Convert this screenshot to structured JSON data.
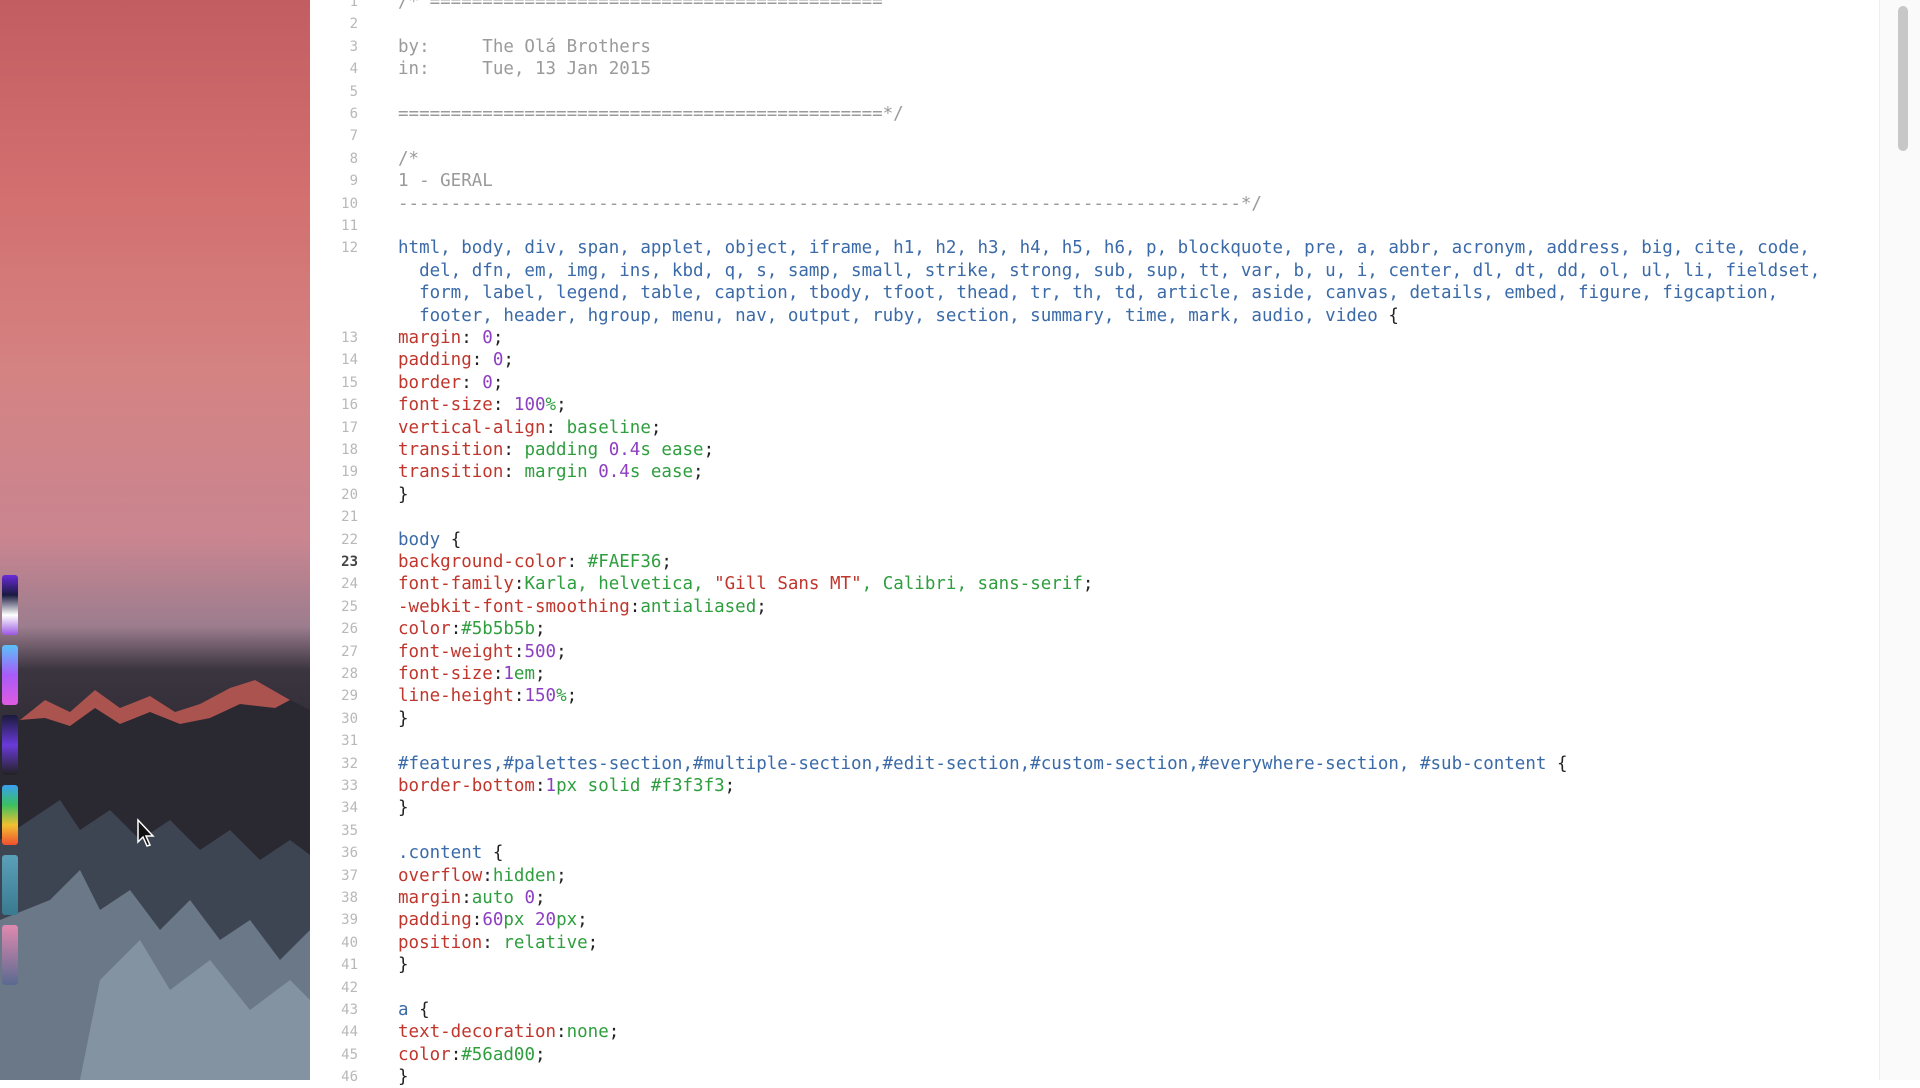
{
  "editor": {
    "lines": [
      {
        "n": "1",
        "tokens": [
          {
            "c": "comment",
            "t": "/* ==========================================="
          }
        ]
      },
      {
        "n": "2",
        "tokens": []
      },
      {
        "n": "3",
        "tokens": [
          {
            "c": "comment",
            "t": "by:     The Olá Brothers"
          }
        ]
      },
      {
        "n": "4",
        "tokens": [
          {
            "c": "comment",
            "t": "in:     Tue, 13 Jan 2015"
          }
        ]
      },
      {
        "n": "5",
        "tokens": []
      },
      {
        "n": "6",
        "tokens": [
          {
            "c": "comment",
            "t": "==============================================*/"
          }
        ]
      },
      {
        "n": "7",
        "tokens": []
      },
      {
        "n": "8",
        "tokens": [
          {
            "c": "comment",
            "t": "/*"
          }
        ]
      },
      {
        "n": "9",
        "tokens": [
          {
            "c": "comment",
            "t": "1 - GERAL"
          }
        ]
      },
      {
        "n": "10",
        "tokens": [
          {
            "c": "comment",
            "t": "--------------------------------------------------------------------------------*/"
          }
        ]
      },
      {
        "n": "11",
        "tokens": []
      },
      {
        "n": "12",
        "tokens": [
          {
            "c": "sel",
            "t": "html, body, div, span, applet, object, iframe, h1, h2, h3, h4, h5, h6, p, blockquote, pre, a, abbr, acronym, address, big, cite, code,"
          }
        ]
      },
      {
        "n": "",
        "tokens": [
          {
            "c": "sel",
            "t": "  del, dfn, em, img, ins, kbd, q, s, samp, small, strike, strong, sub, sup, tt, var, b, u, i, center, dl, dt, dd, ol, ul, li, fieldset,"
          }
        ]
      },
      {
        "n": "",
        "tokens": [
          {
            "c": "sel",
            "t": "  form, label, legend, table, caption, tbody, tfoot, thead, tr, th, td, article, aside, canvas, details, embed, figure, figcaption,"
          }
        ]
      },
      {
        "n": "",
        "tokens": [
          {
            "c": "sel",
            "t": "  footer, header, hgroup, menu, nav, output, ruby, section, summary, time, mark, audio, video "
          },
          {
            "c": "pun",
            "t": "{"
          }
        ]
      },
      {
        "n": "13",
        "tokens": [
          {
            "c": "prop",
            "t": "margin"
          },
          {
            "c": "pun",
            "t": ": "
          },
          {
            "c": "num",
            "t": "0"
          },
          {
            "c": "pun",
            "t": ";"
          }
        ]
      },
      {
        "n": "14",
        "tokens": [
          {
            "c": "prop",
            "t": "padding"
          },
          {
            "c": "pun",
            "t": ": "
          },
          {
            "c": "num",
            "t": "0"
          },
          {
            "c": "pun",
            "t": ";"
          }
        ]
      },
      {
        "n": "15",
        "tokens": [
          {
            "c": "prop",
            "t": "border"
          },
          {
            "c": "pun",
            "t": ": "
          },
          {
            "c": "num",
            "t": "0"
          },
          {
            "c": "pun",
            "t": ";"
          }
        ]
      },
      {
        "n": "16",
        "tokens": [
          {
            "c": "prop",
            "t": "font-size"
          },
          {
            "c": "pun",
            "t": ": "
          },
          {
            "c": "num",
            "t": "100"
          },
          {
            "c": "val",
            "t": "%"
          },
          {
            "c": "pun",
            "t": ";"
          }
        ]
      },
      {
        "n": "17",
        "tokens": [
          {
            "c": "prop",
            "t": "vertical-align"
          },
          {
            "c": "pun",
            "t": ": "
          },
          {
            "c": "val",
            "t": "baseline"
          },
          {
            "c": "pun",
            "t": ";"
          }
        ]
      },
      {
        "n": "18",
        "tokens": [
          {
            "c": "prop",
            "t": "transition"
          },
          {
            "c": "pun",
            "t": ": "
          },
          {
            "c": "val",
            "t": "padding "
          },
          {
            "c": "num",
            "t": "0.4"
          },
          {
            "c": "val",
            "t": "s ease"
          },
          {
            "c": "pun",
            "t": ";"
          }
        ]
      },
      {
        "n": "19",
        "tokens": [
          {
            "c": "prop",
            "t": "transition"
          },
          {
            "c": "pun",
            "t": ": "
          },
          {
            "c": "val",
            "t": "margin "
          },
          {
            "c": "num",
            "t": "0.4"
          },
          {
            "c": "val",
            "t": "s ease"
          },
          {
            "c": "pun",
            "t": ";"
          }
        ]
      },
      {
        "n": "20",
        "tokens": [
          {
            "c": "pun",
            "t": "}"
          }
        ]
      },
      {
        "n": "21",
        "tokens": []
      },
      {
        "n": "22",
        "tokens": [
          {
            "c": "sel",
            "t": "body "
          },
          {
            "c": "pun",
            "t": "{"
          }
        ]
      },
      {
        "n": "23",
        "active": true,
        "tokens": [
          {
            "c": "prop",
            "t": "background-color"
          },
          {
            "c": "pun",
            "t": ": "
          },
          {
            "c": "val",
            "t": "#FAEF36"
          },
          {
            "c": "pun",
            "t": ";"
          }
        ]
      },
      {
        "n": "24",
        "tokens": [
          {
            "c": "prop",
            "t": "font-family"
          },
          {
            "c": "pun",
            "t": ":"
          },
          {
            "c": "val",
            "t": "Karla, helvetica, "
          },
          {
            "c": "str",
            "t": "\"Gill Sans MT\""
          },
          {
            "c": "val",
            "t": ", Calibri, sans-serif"
          },
          {
            "c": "pun",
            "t": ";"
          }
        ]
      },
      {
        "n": "25",
        "tokens": [
          {
            "c": "prop",
            "t": "-webkit-font-smoothing"
          },
          {
            "c": "pun",
            "t": ":"
          },
          {
            "c": "val",
            "t": "antialiased"
          },
          {
            "c": "pun",
            "t": ";"
          }
        ]
      },
      {
        "n": "26",
        "tokens": [
          {
            "c": "prop",
            "t": "color"
          },
          {
            "c": "pun",
            "t": ":"
          },
          {
            "c": "val",
            "t": "#5b5b5b"
          },
          {
            "c": "pun",
            "t": ";"
          }
        ]
      },
      {
        "n": "27",
        "tokens": [
          {
            "c": "prop",
            "t": "font-weight"
          },
          {
            "c": "pun",
            "t": ":"
          },
          {
            "c": "num",
            "t": "500"
          },
          {
            "c": "pun",
            "t": ";"
          }
        ]
      },
      {
        "n": "28",
        "tokens": [
          {
            "c": "prop",
            "t": "font-size"
          },
          {
            "c": "pun",
            "t": ":"
          },
          {
            "c": "num",
            "t": "1"
          },
          {
            "c": "val",
            "t": "em"
          },
          {
            "c": "pun",
            "t": ";"
          }
        ]
      },
      {
        "n": "29",
        "tokens": [
          {
            "c": "prop",
            "t": "line-height"
          },
          {
            "c": "pun",
            "t": ":"
          },
          {
            "c": "num",
            "t": "150"
          },
          {
            "c": "val",
            "t": "%"
          },
          {
            "c": "pun",
            "t": ";"
          }
        ]
      },
      {
        "n": "30",
        "tokens": [
          {
            "c": "pun",
            "t": "}"
          }
        ]
      },
      {
        "n": "31",
        "tokens": []
      },
      {
        "n": "32",
        "tokens": [
          {
            "c": "sel",
            "t": "#features,#palettes-section,#multiple-section,#edit-section,#custom-section,#everywhere-section, #sub-content "
          },
          {
            "c": "pun",
            "t": "{"
          }
        ]
      },
      {
        "n": "33",
        "tokens": [
          {
            "c": "prop",
            "t": "border-bottom"
          },
          {
            "c": "pun",
            "t": ":"
          },
          {
            "c": "num",
            "t": "1"
          },
          {
            "c": "val",
            "t": "px solid #f3f3f3"
          },
          {
            "c": "pun",
            "t": ";"
          }
        ]
      },
      {
        "n": "34",
        "tokens": [
          {
            "c": "pun",
            "t": "}"
          }
        ]
      },
      {
        "n": "35",
        "tokens": []
      },
      {
        "n": "36",
        "tokens": [
          {
            "c": "sel",
            "t": ".content "
          },
          {
            "c": "pun",
            "t": "{"
          }
        ]
      },
      {
        "n": "37",
        "tokens": [
          {
            "c": "prop",
            "t": "overflow"
          },
          {
            "c": "pun",
            "t": ":"
          },
          {
            "c": "val",
            "t": "hidden"
          },
          {
            "c": "pun",
            "t": ";"
          }
        ]
      },
      {
        "n": "38",
        "tokens": [
          {
            "c": "prop",
            "t": "margin"
          },
          {
            "c": "pun",
            "t": ":"
          },
          {
            "c": "val",
            "t": "auto "
          },
          {
            "c": "num",
            "t": "0"
          },
          {
            "c": "pun",
            "t": ";"
          }
        ]
      },
      {
        "n": "39",
        "tokens": [
          {
            "c": "prop",
            "t": "padding"
          },
          {
            "c": "pun",
            "t": ":"
          },
          {
            "c": "num",
            "t": "60"
          },
          {
            "c": "val",
            "t": "px "
          },
          {
            "c": "num",
            "t": "20"
          },
          {
            "c": "val",
            "t": "px"
          },
          {
            "c": "pun",
            "t": ";"
          }
        ]
      },
      {
        "n": "40",
        "tokens": [
          {
            "c": "prop",
            "t": "position"
          },
          {
            "c": "pun",
            "t": ": "
          },
          {
            "c": "val",
            "t": "relative"
          },
          {
            "c": "pun",
            "t": ";"
          }
        ]
      },
      {
        "n": "41",
        "tokens": [
          {
            "c": "pun",
            "t": "}"
          }
        ]
      },
      {
        "n": "42",
        "tokens": []
      },
      {
        "n": "43",
        "tokens": [
          {
            "c": "sel",
            "t": "a "
          },
          {
            "c": "pun",
            "t": "{"
          }
        ]
      },
      {
        "n": "44",
        "tokens": [
          {
            "c": "prop",
            "t": "text-decoration"
          },
          {
            "c": "pun",
            "t": ":"
          },
          {
            "c": "val",
            "t": "none"
          },
          {
            "c": "pun",
            "t": ";"
          }
        ]
      },
      {
        "n": "45",
        "tokens": [
          {
            "c": "prop",
            "t": "color"
          },
          {
            "c": "pun",
            "t": ":"
          },
          {
            "c": "val",
            "t": "#56ad00"
          },
          {
            "c": "pun",
            "t": ";"
          }
        ]
      },
      {
        "n": "46",
        "tokens": [
          {
            "c": "pun",
            "t": "}"
          }
        ]
      }
    ]
  },
  "colors": {
    "comment": "#9a9a9a",
    "selector": "#3a6aa8",
    "property": "#c0362c",
    "value": "#2e9e3e",
    "number": "#8d3fc2"
  },
  "desktop": {
    "icons": [
      "mouse-cursor-icon"
    ]
  }
}
